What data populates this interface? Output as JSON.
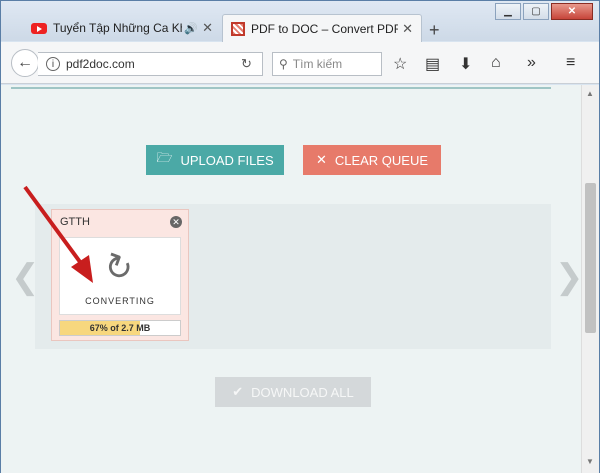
{
  "browser": {
    "tabs": [
      {
        "title": "Tuyển Tập Những Ca Khúc",
        "icon": "youtube-icon",
        "audio": true
      },
      {
        "title": "PDF to DOC – Convert PDF to",
        "icon": "pdf-icon",
        "active": true
      }
    ],
    "new_tab": "+",
    "address": "pdf2doc.com",
    "search_placeholder": "Tìm kiếm"
  },
  "page": {
    "upload_label": "UPLOAD FILES",
    "clear_label": "CLEAR QUEUE",
    "download_label": "DOWNLOAD ALL",
    "file": {
      "name": "GTTH",
      "status": "CONVERTING",
      "progress_text": "67% of 2.7 MB",
      "progress": 0.67
    },
    "prev_arrow": "❮",
    "next_arrow": "❯"
  },
  "colors": {
    "upload": "#4ba9a6",
    "clear": "#e77a6a",
    "download_disabled": "#d4d8da",
    "progress_fill": "#f7d77e",
    "annotation_arrow": "#c81e1e"
  }
}
